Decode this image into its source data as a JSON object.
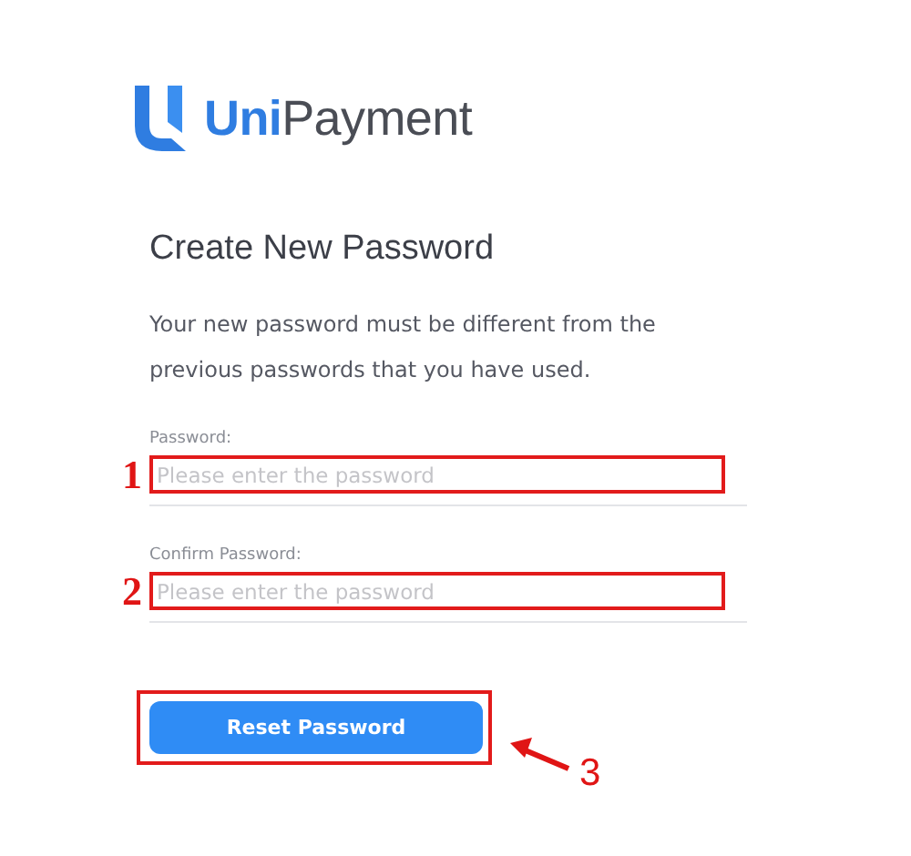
{
  "logo": {
    "first": "Uni",
    "second": "Payment"
  },
  "title": "Create New Password",
  "description": "Your new password must be different from the previous passwords that you have used.",
  "fields": [
    {
      "label": "Password:",
      "placeholder": "Please enter the password",
      "marker": "1"
    },
    {
      "label": "Confirm Password:",
      "placeholder": "Please enter the password",
      "marker": "2"
    }
  ],
  "button": {
    "label": "Reset Password",
    "marker": "3"
  }
}
